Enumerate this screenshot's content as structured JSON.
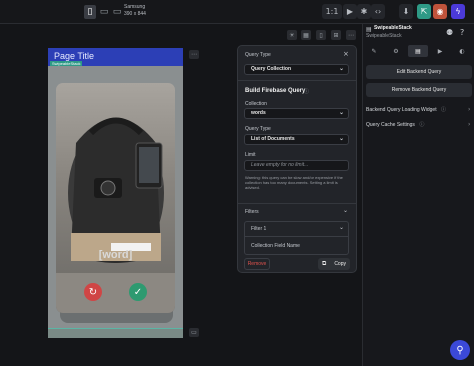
{
  "device": {
    "label_line1": "Samsung",
    "label_line2": "390 x 844"
  },
  "toolbar_right": {
    "zoom_label": "1:1"
  },
  "phone": {
    "page_title": "Page Title",
    "widget_tag": "SwipeableStack",
    "card_word": "[word]"
  },
  "query_panel": {
    "query_type_label": "Query Type",
    "query_type_value": "Query Collection",
    "section_title": "Build Firebase Query",
    "collection_label": "Collection",
    "collection_value": "words",
    "query_type2_label": "Query Type",
    "query_type2_value": "List of Documents",
    "limit_label": "Limit",
    "limit_placeholder": "Leave empty for no limit...",
    "warning_text": "Warning: this query can be slow and/or expensive if the collection has too many documents. Setting a limit is advised.",
    "filters_label": "Filters",
    "filter_item": "Filter 1",
    "filter_field_label": "Collection Field Name",
    "remove_label": "Remove",
    "copy_label": "Copy"
  },
  "right_panel": {
    "widget_name": "SwipeableStack",
    "widget_sub": "SwipeableStack",
    "edit_query": "Edit Backend Query",
    "remove_query": "Remove Backend Query",
    "loading_widget": "Backend Query Loading Widget",
    "cache_settings": "Query Cache Settings"
  },
  "colors": {
    "accent_blue": "#3b49d8",
    "tag_green": "#2e9a86",
    "header_blue": "#2c3fb6",
    "remove_red": "#e0524d"
  }
}
